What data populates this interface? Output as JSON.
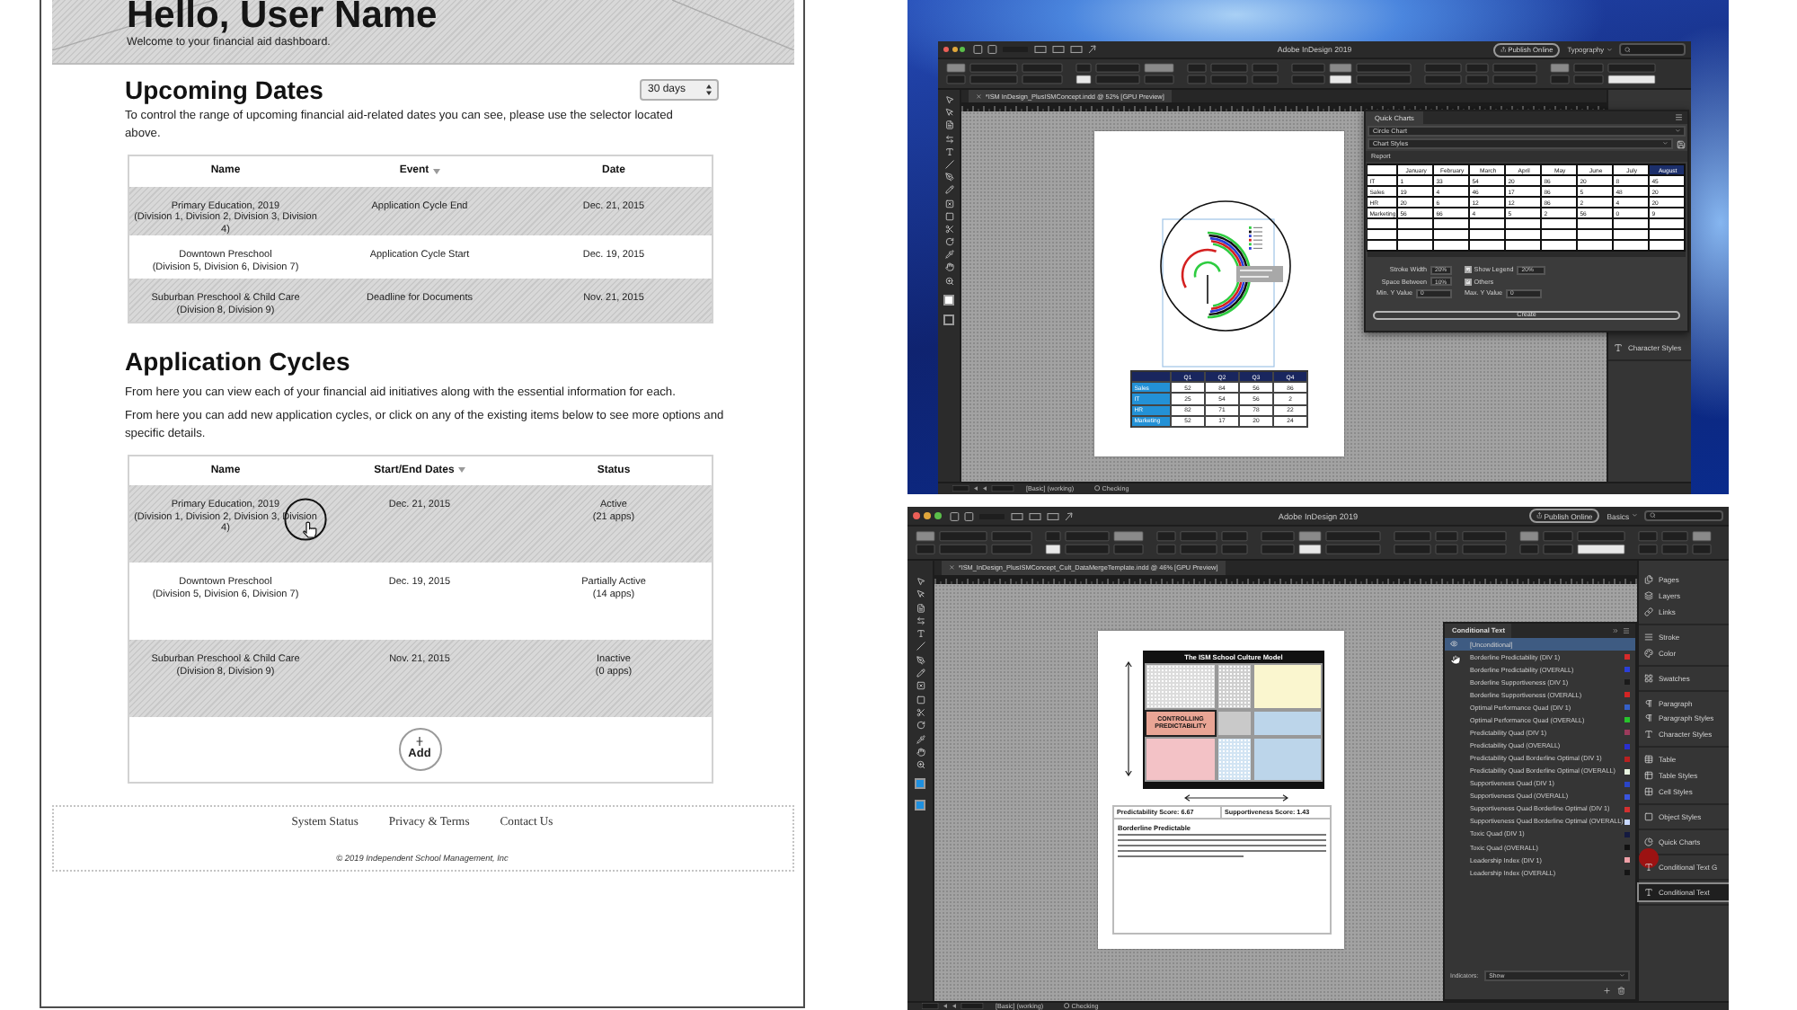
{
  "dashboard": {
    "greeting": "Hello, User Name",
    "welcome": "Welcome to your financial aid dashboard.",
    "upcoming": {
      "title": "Upcoming Dates",
      "range": "30 days",
      "description": "To control the range of upcoming financial aid-related dates you can see, please use the selector located above.",
      "columns": [
        {
          "label": "Name",
          "sorted": false
        },
        {
          "label": "Event",
          "sorted": true
        },
        {
          "label": "Date",
          "sorted": false
        }
      ],
      "rows": [
        {
          "name": "Primary Education, 2019",
          "divisions": "(Division 1, Division 2, Division 3, Division 4)",
          "event": "Application Cycle End",
          "date": "Dec. 21, 2015"
        },
        {
          "name": "Downtown Preschool",
          "divisions": "(Division 5, Division 6, Division 7)",
          "event": "Application Cycle Start",
          "date": "Dec. 19, 2015"
        },
        {
          "name": "Suburban Preschool & Child Care",
          "divisions": "(Division 8, Division 9)",
          "event": "Deadline for Documents",
          "date": "Nov. 21, 2015"
        }
      ]
    },
    "cycles": {
      "title": "Application Cycles",
      "descriptions": [
        "From here you can view each of your financial aid initiatives along with the essential information for each.",
        "From here you can add new application cycles, or click on any of the existing items below to see more options and specific details."
      ],
      "columns": [
        {
          "label": "Name",
          "sorted": false
        },
        {
          "label": "Start/End Dates",
          "sorted": true
        },
        {
          "label": "Status",
          "sorted": false
        }
      ],
      "rows": [
        {
          "name": "Primary Education, 2019",
          "divisions": "(Division 1, Division 2, Division 3, Division 4)",
          "dates": "Dec. 21, 2015",
          "status": "Active",
          "apps": "(21 apps)",
          "pointer": true
        },
        {
          "name": "Downtown Preschool",
          "divisions": "(Division 5, Division 6, Division 7)",
          "dates": "Dec. 19, 2015",
          "status": "Partially Active",
          "apps": "(14 apps)",
          "pointer": false
        },
        {
          "name": "Suburban Preschool & Child Care",
          "divisions": "(Division 8, Division 9)",
          "dates": "Nov. 21, 2015",
          "status": "Inactive",
          "apps": "(0 apps)",
          "pointer": false
        }
      ],
      "add_button": "Add"
    },
    "footer": {
      "links": [
        "System Status",
        "Privacy & Terms",
        "Contact Us"
      ],
      "copyright": "© 2019 Independent School Management, Inc"
    }
  },
  "charts_window": {
    "title": "Adobe InDesign 2019",
    "publish_button": "Publish Online",
    "workspace": "Typography",
    "document_tab": "*ISM InDesign_PlusISMConcept.indd @ 52% [GPU Preview]",
    "page_table": {
      "columns": [
        "Q1",
        "Q2",
        "Q3",
        "Q4"
      ],
      "rows": [
        {
          "label": "Sales",
          "values": [
            "52",
            "84",
            "56",
            "86"
          ]
        },
        {
          "label": "IT",
          "values": [
            "25",
            "54",
            "56",
            "2"
          ]
        },
        {
          "label": "HR",
          "values": [
            "82",
            "71",
            "78",
            "22"
          ]
        },
        {
          "label": "Marketing",
          "values": [
            "52",
            "17",
            "20",
            "24"
          ]
        }
      ]
    },
    "panel": {
      "tab": "Quick Charts",
      "chart_type": "Circle Chart",
      "chart_style": "Chart Styles",
      "section": "Report",
      "months": [
        {
          "label": "January",
          "selected": false
        },
        {
          "label": "February",
          "selected": false
        },
        {
          "label": "March",
          "selected": false
        },
        {
          "label": "April",
          "selected": false
        },
        {
          "label": "May",
          "selected": false
        },
        {
          "label": "June",
          "selected": false
        },
        {
          "label": "July",
          "selected": false
        },
        {
          "label": "August",
          "selected": true
        }
      ],
      "rows": [
        {
          "label": "IT",
          "values": [
            "1",
            "33",
            "54",
            "20",
            "86",
            "20",
            "8",
            "45"
          ]
        },
        {
          "label": "Sales",
          "values": [
            "19",
            "4",
            "46",
            "17",
            "86",
            "5",
            "48",
            "20"
          ]
        },
        {
          "label": "HR",
          "values": [
            "20",
            "6",
            "12",
            "12",
            "86",
            "2",
            "4",
            "20"
          ]
        },
        {
          "label": "Marketing",
          "values": [
            "56",
            "66",
            "4",
            "5",
            "2",
            "56",
            "0",
            "9"
          ]
        }
      ],
      "fields": [
        {
          "label": "Stroke Width",
          "value": "20%"
        },
        {
          "label": "Space Between",
          "value": "10%"
        },
        {
          "label": "Min. Y Value",
          "value": "0"
        }
      ],
      "checks": [
        {
          "label": "Show Legend",
          "checked": true,
          "value": "20%"
        },
        {
          "label": "Others",
          "checked": true
        }
      ],
      "extra_field": {
        "label": "Max. Y Value",
        "value": "0"
      },
      "create_button": "Create"
    },
    "dock": [
      {
        "items": [
          {
            "label": "Character Styles",
            "kind": "charstyles",
            "selected": false,
            "pointer": false
          }
        ]
      }
    ],
    "status": "[Basic] (working)",
    "preflight": "Checking"
  },
  "conditional_window": {
    "title": "Adobe InDesign 2019",
    "publish_button": "Publish Online",
    "workspace": "Basics",
    "document_tab": "*ISM_InDesign_PlusISMConcept_Cult_DataMergeTemplate.indd @ 46% [GPU Preview]",
    "document": {
      "diagram_title": "The ISM School Culture Model",
      "highlight_cell": "CONTROLLING PREDICTABILITY",
      "scores": [
        "Predictability Score: 6.67",
        "Supportiveness Score: 1.43"
      ],
      "heading": "Borderline Predictable"
    },
    "panel": {
      "tab": "Conditional Text",
      "items": [
        {
          "label": "[Unconditional]",
          "selected": true,
          "visible": true,
          "pointer": false
        },
        {
          "label": "Borderline Predictability (DIV 1)",
          "selected": false,
          "visible": false,
          "pointer": true,
          "color": "#d62a2a"
        },
        {
          "label": "Borderline Predictability (OVERALL)",
          "selected": false,
          "visible": false,
          "pointer": false,
          "color": "#2b3fd8"
        },
        {
          "label": "Borderline Supportiveness (DIV 1)",
          "selected": false,
          "visible": false,
          "pointer": false,
          "color": "#1a1a1a"
        },
        {
          "label": "Borderline Supportiveness (OVERALL)",
          "selected": false,
          "visible": false,
          "pointer": false,
          "color": "#d42424"
        },
        {
          "label": "Optimal Performance Quad (DIV 1)",
          "selected": false,
          "visible": false,
          "pointer": false,
          "color": "#3560c8"
        },
        {
          "label": "Optimal Performance Quad (OVERALL)",
          "selected": false,
          "visible": false,
          "pointer": false,
          "color": "#27c42c"
        },
        {
          "label": "Predictability Quad (DIV 1)",
          "selected": false,
          "visible": false,
          "pointer": false,
          "color": "#9c3b5c"
        },
        {
          "label": "Predictability Quad (OVERALL)",
          "selected": false,
          "visible": false,
          "pointer": false,
          "color": "#2a2fd0"
        },
        {
          "label": "Predictability Quad Borderline Optimal (DIV 1)",
          "selected": false,
          "visible": false,
          "pointer": false,
          "color": "#b82020"
        },
        {
          "label": "Predictability Quad Borderline Optimal (OVERALL)",
          "selected": false,
          "visible": false,
          "pointer": false,
          "color": "#e8f4e0"
        },
        {
          "label": "Supportiveness Quad (DIV 1)",
          "selected": false,
          "visible": false,
          "pointer": false,
          "color": "#2a45c8"
        },
        {
          "label": "Supportiveness Quad (OVERALL)",
          "selected": false,
          "visible": false,
          "pointer": false,
          "color": "#3a55e0"
        },
        {
          "label": "Supportiveness Quad Borderline Optimal (DIV 1)",
          "selected": false,
          "visible": false,
          "pointer": false,
          "color": "#d23030"
        },
        {
          "label": "Supportiveness Quad Borderline Optimal (OVERALL)",
          "selected": false,
          "visible": false,
          "pointer": false,
          "color": "#c8d8ff"
        },
        {
          "label": "Toxic Quad (DIV 1)",
          "selected": false,
          "visible": false,
          "pointer": false,
          "color": "#141a40"
        },
        {
          "label": "Toxic Quad (OVERALL)",
          "selected": false,
          "visible": false,
          "pointer": false,
          "color": "#111111"
        },
        {
          "label": "Leadership Index (DIV 1)",
          "selected": false,
          "visible": false,
          "pointer": false,
          "color": "#f0a0a8"
        },
        {
          "label": "Leadership Index (OVERALL)",
          "selected": false,
          "visible": false,
          "pointer": false,
          "color": "#151515"
        }
      ],
      "indicators_label": "Indicators:",
      "indicators_value": "Show"
    },
    "dock": [
      {
        "items": [
          {
            "label": "Pages",
            "kind": "pages",
            "selected": false,
            "pointer": false
          },
          {
            "label": "Layers",
            "kind": "layers",
            "selected": false,
            "pointer": false
          },
          {
            "label": "Links",
            "kind": "links",
            "selected": false,
            "pointer": false
          }
        ]
      },
      {
        "items": [
          {
            "label": "Stroke",
            "kind": "stroke",
            "selected": false,
            "pointer": false
          },
          {
            "label": "Color",
            "kind": "color",
            "selected": false,
            "pointer": false
          }
        ]
      },
      {
        "items": [
          {
            "label": "Swatches",
            "kind": "swatches",
            "selected": false,
            "pointer": false
          }
        ]
      },
      {
        "items": [
          {
            "label": "Paragraph",
            "kind": "paragraph",
            "selected": false,
            "pointer": false
          },
          {
            "label": "Paragraph Styles",
            "kind": "parastyles",
            "selected": false,
            "pointer": false
          },
          {
            "label": "Character Styles",
            "kind": "charstyles",
            "selected": false,
            "pointer": false
          }
        ]
      },
      {
        "items": [
          {
            "label": "Table",
            "kind": "table",
            "selected": false,
            "pointer": false
          },
          {
            "label": "Table Styles",
            "kind": "tablestyles",
            "selected": false,
            "pointer": false
          },
          {
            "label": "Cell Styles",
            "kind": "cellstyles",
            "selected": false,
            "pointer": false
          }
        ]
      },
      {
        "items": [
          {
            "label": "Object Styles",
            "kind": "objectstyles",
            "selected": false,
            "pointer": false
          }
        ]
      },
      {
        "items": [
          {
            "label": "Quick Charts",
            "kind": "charts",
            "selected": false,
            "pointer": false
          }
        ]
      },
      {
        "items": [
          {
            "label": "Conditional Text G",
            "kind": "condgroups",
            "selected": false,
            "pointer": true
          }
        ]
      },
      {
        "items": [
          {
            "label": "Conditional Text",
            "kind": "conditional",
            "selected": true,
            "pointer": false
          }
        ]
      }
    ],
    "status": "[Basic] (working)",
    "preflight": "Checking"
  }
}
